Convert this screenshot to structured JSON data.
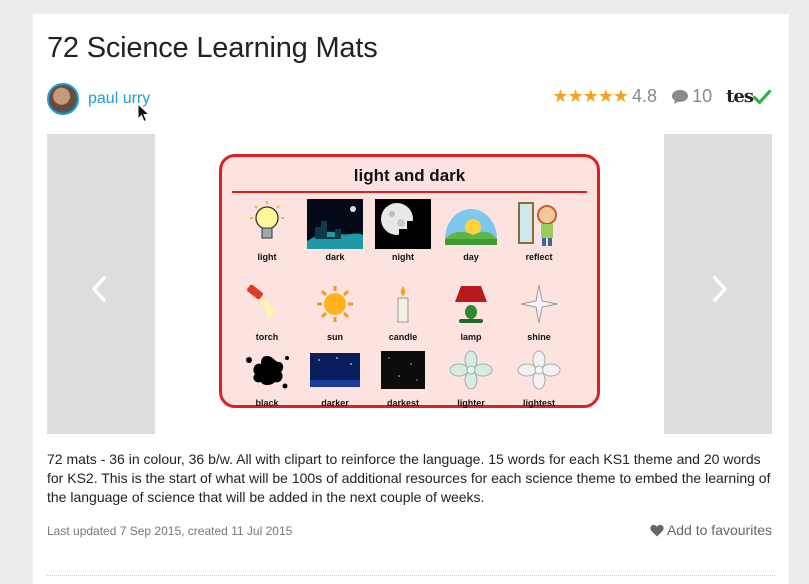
{
  "resource": {
    "title": "72 Science Learning Mats",
    "author": "paul urry",
    "rating": "4.8",
    "stars": "★★★★★",
    "comment_count": "10",
    "brand": "tes"
  },
  "preview": {
    "mat_title": "light and dark",
    "words": [
      "light",
      "dark",
      "night",
      "day",
      "reflect",
      "torch",
      "sun",
      "candle",
      "lamp",
      "shine",
      "black",
      "darker",
      "darkest",
      "lighter",
      "lightest"
    ]
  },
  "description": "72 mats - 36 in colour, 36 b/w. All with clipart to reinforce the language. 15 words for each KS1 theme and 20 words for KS2. This is the start of what will be 100s of additional resources for each science theme to embed the learning of the language of science that will be added in the next couple of weeks.",
  "footer": {
    "updated": "Last updated 7 Sep 2015, created 11 Jul 2015",
    "favourite": "Add to favourites"
  },
  "colors": {
    "link": "#1a9fd7",
    "star": "#f4a321",
    "mat_border": "#e02020",
    "mat_background": "#fde3df",
    "check": "#2fb44a"
  },
  "icons": {
    "comment": "speech-bubble",
    "verified": "check-mark",
    "prev": "chevron-left",
    "next": "chevron-right",
    "favourite": "heart"
  }
}
